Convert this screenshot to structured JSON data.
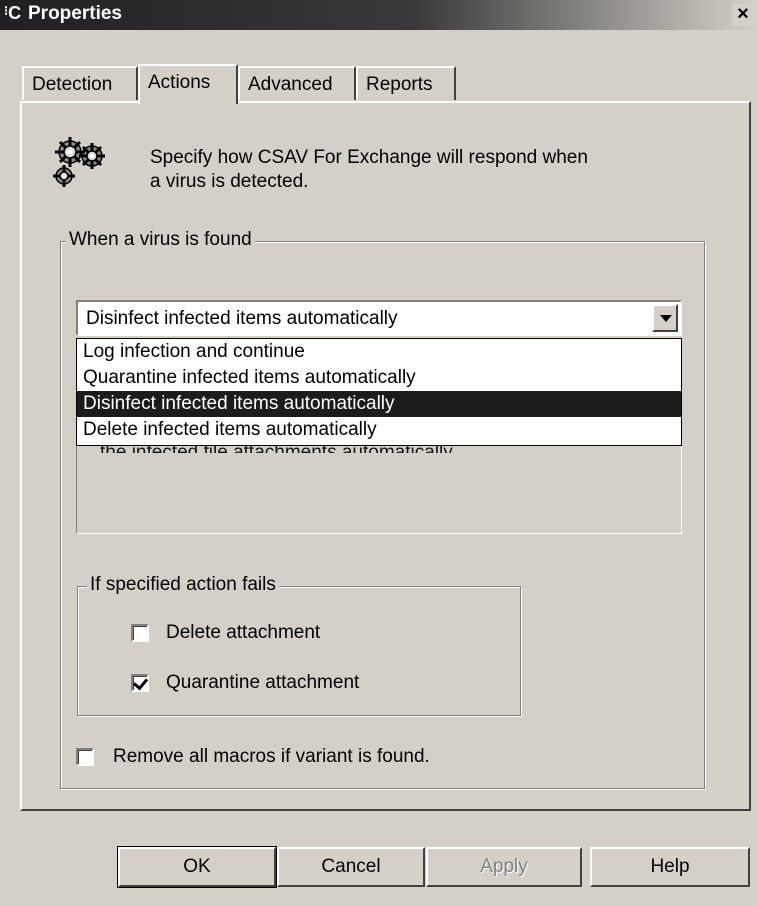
{
  "window": {
    "title": "Properties",
    "app_icon": "C",
    "close_glyph": "×"
  },
  "tabs": [
    {
      "label": "Detection"
    },
    {
      "label": "Actions"
    },
    {
      "label": "Advanced"
    },
    {
      "label": "Reports"
    }
  ],
  "active_tab": "Actions",
  "header": {
    "icon": "gears-icon",
    "line1": "Specify how CSAV For Exchange will respond when",
    "line2": "a virus is detected."
  },
  "virus_found": {
    "legend": "When a virus is found",
    "selected": "Disinfect infected items automatically",
    "options": [
      "Log infection and continue",
      "Quarantine infected items automatically",
      "Disinfect infected items automatically",
      "Delete infected items automatically"
    ],
    "partial_description": "the infected file attachments automatically."
  },
  "action_fails": {
    "legend": "If specified action fails",
    "delete_label": "Delete attachment",
    "delete_checked": false,
    "quarantine_label": "Quarantine attachment",
    "quarantine_checked": true
  },
  "macros": {
    "label": "Remove all macros if variant is found.",
    "checked": false
  },
  "buttons": {
    "ok": "OK",
    "cancel": "Cancel",
    "apply": "Apply",
    "help": "Help"
  },
  "colors": {
    "face": "#d4d0c8",
    "highlight": "#1c1c1c",
    "titlebar": "#202020"
  }
}
